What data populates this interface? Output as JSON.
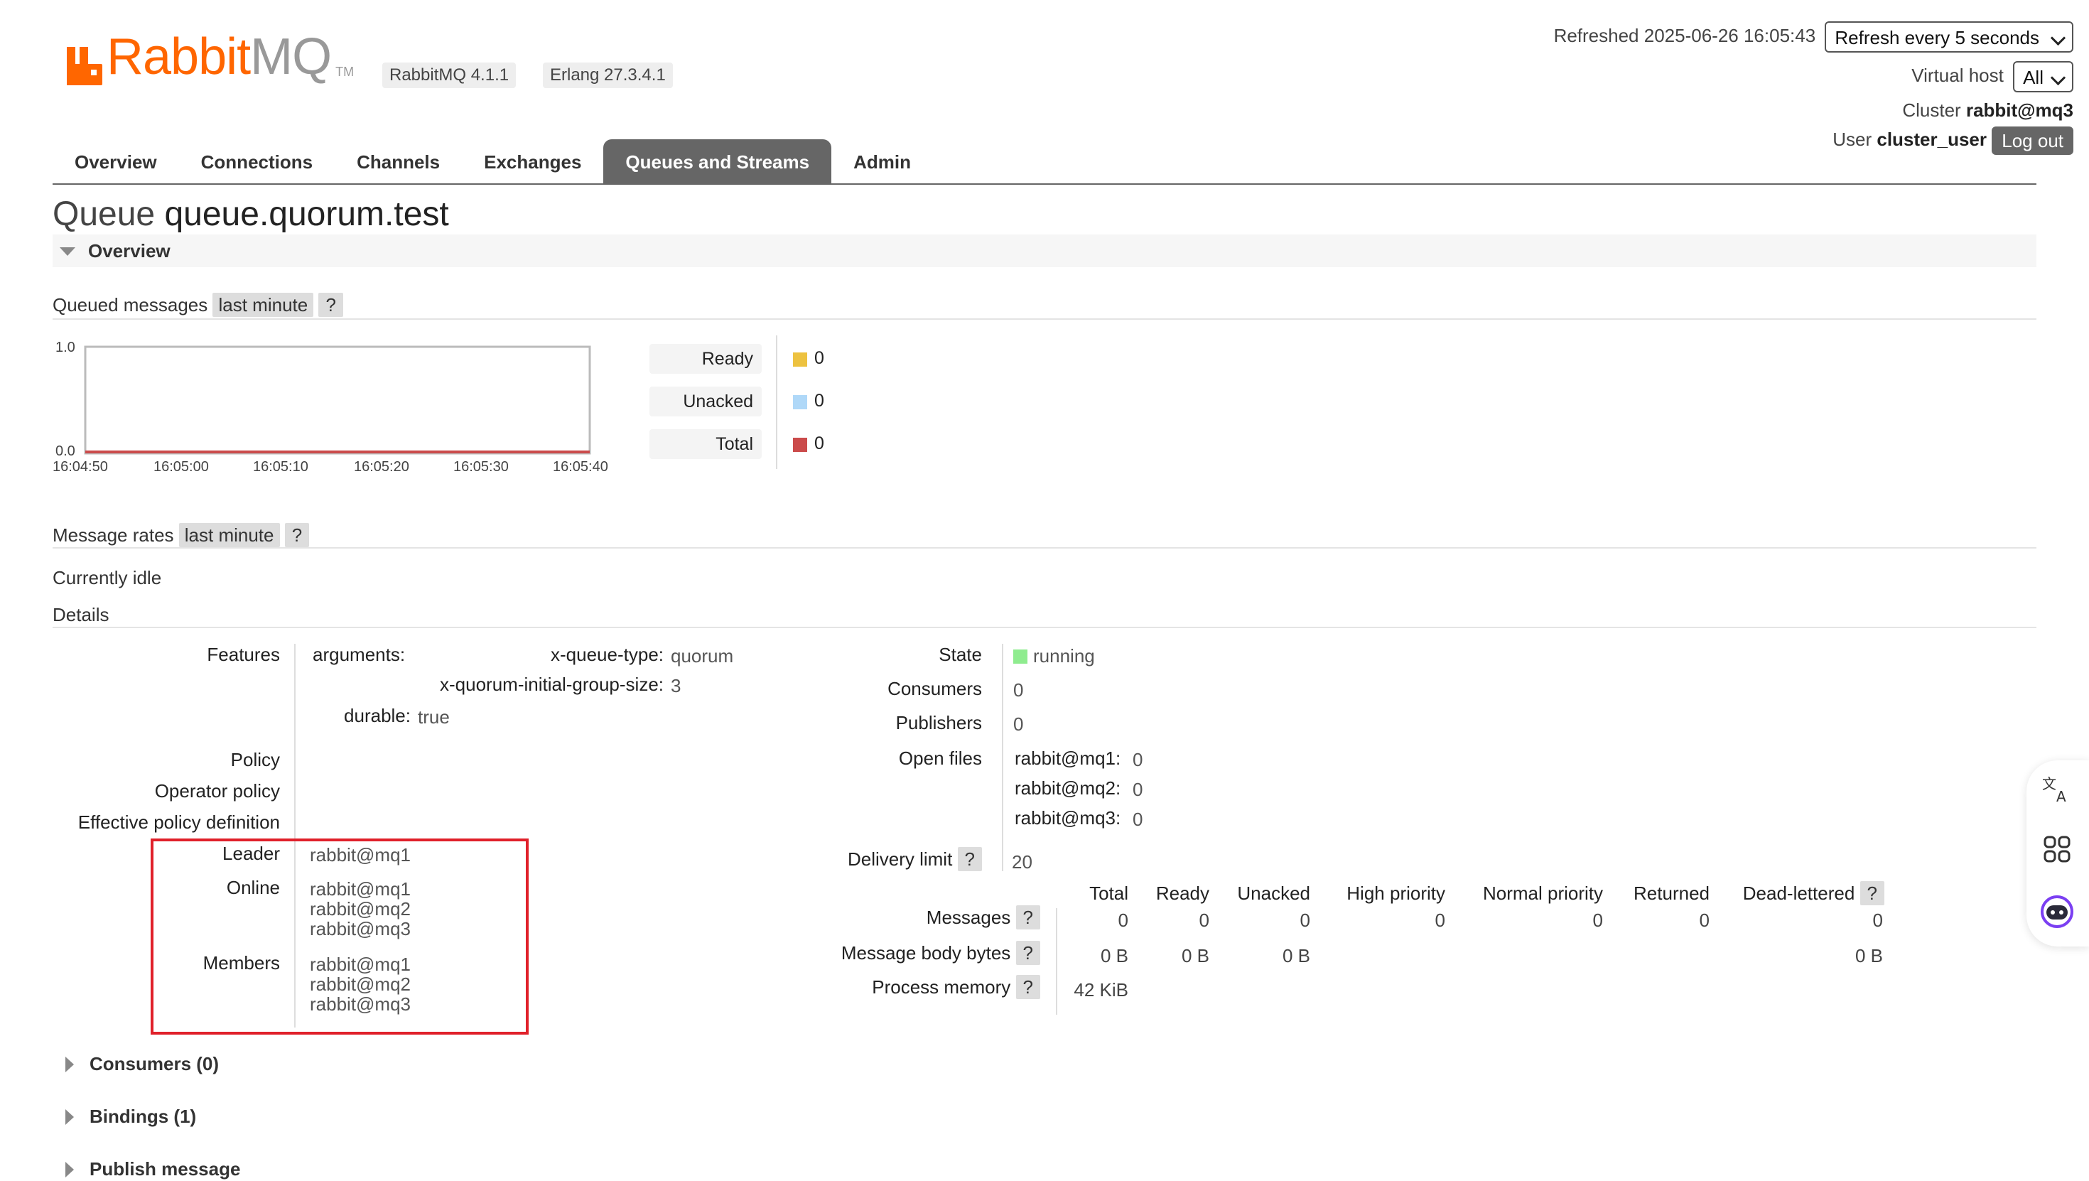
{
  "header": {
    "logo_text_rabbit": "Rabbit",
    "logo_text_mq": "MQ",
    "logo_tm": "TM",
    "version_rabbitmq": "RabbitMQ 4.1.1",
    "version_erlang": "Erlang 27.3.4.1",
    "refreshed_text": "Refreshed 2025-06-26 16:05:43",
    "refresh_select": "Refresh every 5 seconds",
    "virtual_host_label": "Virtual host",
    "virtual_host_value": "All",
    "cluster_label": "Cluster",
    "cluster_value": "rabbit@mq3",
    "user_label": "User",
    "user_value": "cluster_user",
    "logout_label": "Log out"
  },
  "nav": {
    "tabs": [
      {
        "label": "Overview"
      },
      {
        "label": "Connections"
      },
      {
        "label": "Channels"
      },
      {
        "label": "Exchanges"
      },
      {
        "label": "Queues and Streams"
      },
      {
        "label": "Admin"
      }
    ],
    "active_index": 4
  },
  "page": {
    "title_prefix": "Queue",
    "title_name": "queue.quorum.test",
    "overview_section": "Overview"
  },
  "queued_messages": {
    "label": "Queued messages",
    "range": "last minute",
    "help": "?",
    "chart": {
      "y_top": "1.0",
      "y_bottom": "0.0",
      "x_ticks": [
        "16:04:50",
        "16:05:00",
        "16:05:10",
        "16:05:20",
        "16:05:30",
        "16:05:40"
      ]
    },
    "legend": [
      {
        "label": "Ready",
        "value": "0",
        "color": "#edc240"
      },
      {
        "label": "Unacked",
        "value": "0",
        "color": "#afd8f8"
      },
      {
        "label": "Total",
        "value": "0",
        "color": "#cb4b4b"
      }
    ]
  },
  "message_rates": {
    "label": "Message rates",
    "range": "last minute",
    "help": "?",
    "status": "Currently idle"
  },
  "details": {
    "label": "Details",
    "features_label": "Features",
    "arguments_label": "arguments:",
    "arg1_key": "x-queue-type:",
    "arg1_val": "quorum",
    "arg2_key": "x-quorum-initial-group-size:",
    "arg2_val": "3",
    "durable_key": "durable:",
    "durable_val": "true",
    "policy_label": "Policy",
    "operator_policy_label": "Operator policy",
    "effective_policy_label": "Effective policy definition",
    "leader_label": "Leader",
    "leader_value": "rabbit@mq1",
    "online_label": "Online",
    "online_values": [
      "rabbit@mq1",
      "rabbit@mq2",
      "rabbit@mq3"
    ],
    "members_label": "Members",
    "members_values": [
      "rabbit@mq1",
      "rabbit@mq2",
      "rabbit@mq3"
    ],
    "state_label": "State",
    "state_value": "running",
    "state_color": "#8fec8f",
    "consumers_label": "Consumers",
    "consumers_value": "0",
    "publishers_label": "Publishers",
    "publishers_value": "0",
    "open_files_label": "Open files",
    "open_files": [
      {
        "node": "rabbit@mq1:",
        "value": "0"
      },
      {
        "node": "rabbit@mq2:",
        "value": "0"
      },
      {
        "node": "rabbit@mq3:",
        "value": "0"
      }
    ],
    "delivery_limit_label": "Delivery limit",
    "delivery_limit_help": "?",
    "delivery_limit_value": "20"
  },
  "stats": {
    "columns": [
      "Total",
      "Ready",
      "Unacked",
      "High priority",
      "Normal priority",
      "Returned",
      "Dead-lettered"
    ],
    "dead_lettered_help": "?",
    "messages_label": "Messages",
    "messages_help": "?",
    "messages_values": [
      "0",
      "0",
      "0",
      "0",
      "0",
      "0",
      "0"
    ],
    "body_bytes_label": "Message body bytes",
    "body_bytes_help": "?",
    "body_bytes_values": [
      "0 B",
      "0 B",
      "0 B",
      "0 B"
    ],
    "process_memory_label": "Process memory",
    "process_memory_help": "?",
    "process_memory_value": "42 KiB"
  },
  "sections": {
    "consumers": "Consumers (0)",
    "bindings": "Bindings (1)",
    "publish": "Publish message"
  },
  "side_panel": {
    "icons": [
      "translate-icon",
      "apps-grid-icon",
      "assistant-icon"
    ]
  }
}
